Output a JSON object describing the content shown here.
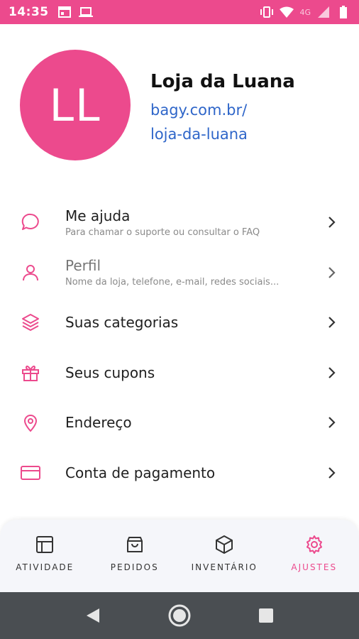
{
  "status_bar": {
    "time": "14:35",
    "network": "4G",
    "icons": [
      "calendar-icon",
      "laptop-icon",
      "vibrate-icon",
      "wifi-icon",
      "signal-icon",
      "battery-icon"
    ]
  },
  "profile": {
    "initials": "LL",
    "store_name": "Loja da Luana",
    "url_line1": "bagy.com.br/",
    "url_line2": "loja-da-luana"
  },
  "menu": {
    "items": [
      {
        "icon": "chat-bubble-icon",
        "title": "Me ajuda",
        "subtitle": "Para chamar o suporte ou consultar o FAQ"
      },
      {
        "icon": "person-icon",
        "title": "Perfil",
        "subtitle": "Nome da loja, telefone, e-mail, redes sociais..."
      },
      {
        "icon": "layers-icon",
        "title": "Suas categorias"
      },
      {
        "icon": "gift-icon",
        "title": "Seus cupons"
      },
      {
        "icon": "location-pin-icon",
        "title": "Endereço"
      },
      {
        "icon": "credit-card-icon",
        "title": "Conta de pagamento"
      }
    ]
  },
  "bottom_nav": {
    "items": [
      {
        "label": "ATIVIDADE",
        "icon": "dashboard-icon"
      },
      {
        "label": "PEDIDOS",
        "icon": "shopping-bag-icon"
      },
      {
        "label": "INVENTÁRIO",
        "icon": "box-icon"
      },
      {
        "label": "AJUSTES",
        "icon": "gear-icon",
        "active": true
      }
    ]
  },
  "colors": {
    "accent": "#ec4a8d",
    "link": "#2f66c9",
    "status_bar": "#ec4a8d",
    "system_nav": "#4a4e52"
  }
}
